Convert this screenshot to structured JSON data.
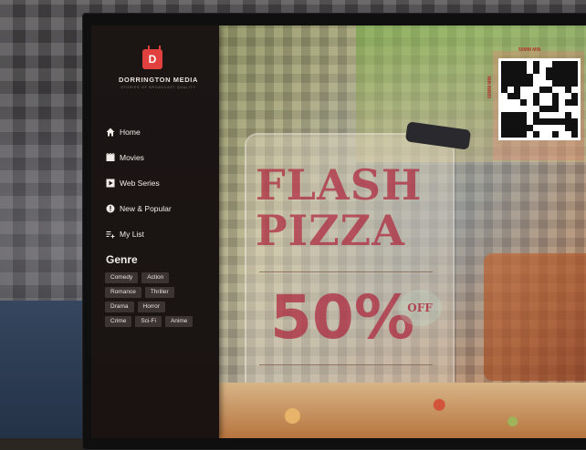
{
  "brand": {
    "logo_letter": "D",
    "name": "DORRINGTON MEDIA",
    "tagline": "STORIES OF BROADCAST QUALITY",
    "accent_color": "#e0413e"
  },
  "nav": {
    "items": [
      {
        "label": "Home",
        "icon": "home-icon"
      },
      {
        "label": "Movies",
        "icon": "movies-icon"
      },
      {
        "label": "Web Series",
        "icon": "play-icon"
      },
      {
        "label": "New & Popular",
        "icon": "info-icon"
      },
      {
        "label": "My List",
        "icon": "list-add-icon"
      }
    ]
  },
  "genre": {
    "title": "Genre",
    "rows": [
      [
        "Comedy",
        "Action"
      ],
      [
        "Romance",
        "Thriller"
      ],
      [
        "Drama",
        "Horror"
      ],
      [
        "Crime",
        "Sci-Fi",
        "Anime"
      ]
    ]
  },
  "promo": {
    "line1": "FLASH",
    "line2": "PIZZA",
    "discount": "50%",
    "off": "OFF",
    "qr_width": "50MM MIN",
    "qr_height": "50MM MIN"
  }
}
